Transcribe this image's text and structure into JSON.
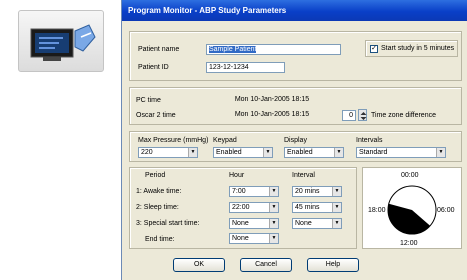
{
  "window": {
    "title": "Program Monitor - ABP Study Parameters"
  },
  "patient": {
    "name_label": "Patient name",
    "name_value": "Sample Patient",
    "id_label": "Patient ID",
    "id_value": "123-12-1234",
    "start_checkbox_label": "Start study in 5 minutes",
    "start_checked_glyph": "✓"
  },
  "time": {
    "pc_label": "PC time",
    "pc_value": "Mon  10-Jan-2005 18:15",
    "oscar_label": "Oscar 2 time",
    "oscar_value": "Mon  10-Jan-2005 18:15",
    "tz_value": "0",
    "tz_label": "Time zone difference"
  },
  "settings": {
    "max_pressure_label": "Max Pressure (mmHg)",
    "max_pressure_value": "220",
    "keypad_label": "Keypad",
    "keypad_value": "Enabled",
    "display_label": "Display",
    "display_value": "Enabled",
    "intervals_label": "Intervals",
    "intervals_value": "Standard"
  },
  "schedule": {
    "period_header": "Period",
    "hour_header": "Hour",
    "interval_header": "Interval",
    "rows": [
      {
        "label": "1: Awake time:",
        "hour": "7:00",
        "interval": "20 mins"
      },
      {
        "label": "2: Sleep time:",
        "hour": "22:00",
        "interval": "45 mins"
      },
      {
        "label": "3: Special start time:",
        "hour": "None",
        "interval": "None"
      },
      {
        "label": "End time:",
        "hour": "None"
      }
    ]
  },
  "clock": {
    "top": "00:00",
    "left": "18:00",
    "right": "06:00",
    "bottom": "12:00"
  },
  "buttons": {
    "ok": "OK",
    "cancel": "Cancel",
    "help": "Help"
  },
  "icons": {
    "app": "monitor-device-icon",
    "dropdown": "chevron-down-icon"
  },
  "colors": {
    "titlebar": "#0a3fc8",
    "dialog": "#ece9d8",
    "selection": "#316ac5"
  }
}
